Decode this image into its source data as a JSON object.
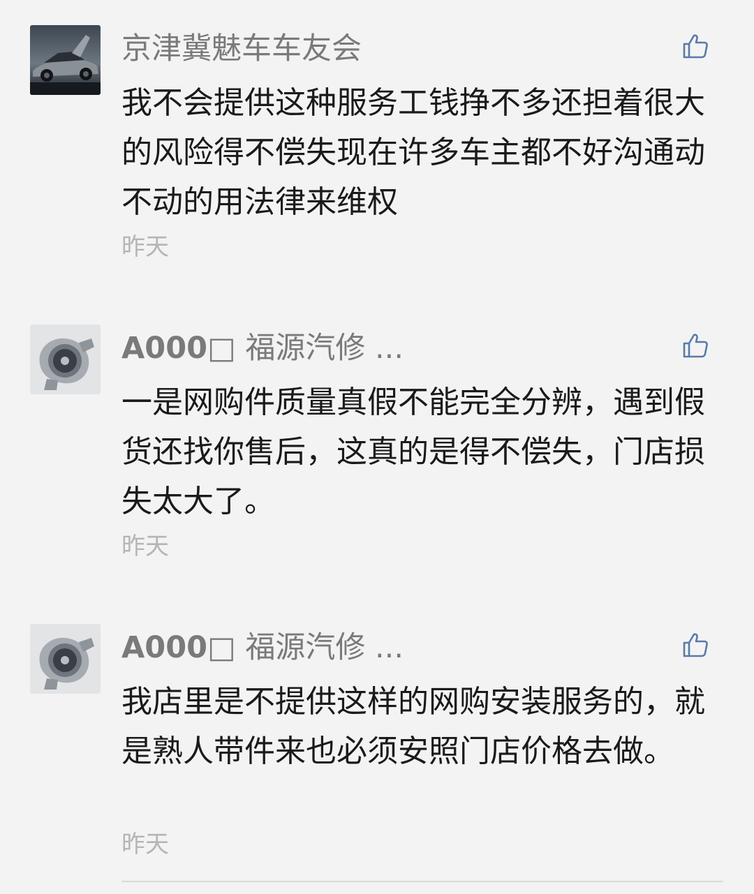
{
  "comments": [
    {
      "nickname": "京津冀魅车车友会",
      "nickname_strong": "",
      "text": "我不会提供这种服务工钱挣不多还担着很大的风险得不偿失现在许多车主都不好沟通动不动的用法律来维权",
      "time": "昨天",
      "avatar": "sports-car-avatar",
      "like_icon": "thumbs-up-icon"
    },
    {
      "nickname": "□ 福源汽修 ...",
      "nickname_strong": "A000",
      "text": "一是网购件质量真假不能完全分辨，遇到假货还找你售后，这真的是得不偿失，门店损失太大了。",
      "time": "昨天",
      "avatar": "turbocharger-avatar",
      "like_icon": "thumbs-up-icon"
    },
    {
      "nickname": "□ 福源汽修 ...",
      "nickname_strong": "A000",
      "text": "我店里是不提供这样的网购安装服务的，就是熟人带件来也必须安照门店价格去做。",
      "time": "昨天",
      "avatar": "turbocharger-avatar",
      "like_icon": "thumbs-up-icon"
    }
  ],
  "colors": {
    "background": "#f3f3f3",
    "nickname": "#7a7a7a",
    "text": "#1a1a1a",
    "time": "#b5b5b5",
    "like_icon": "#5a7aa8"
  }
}
